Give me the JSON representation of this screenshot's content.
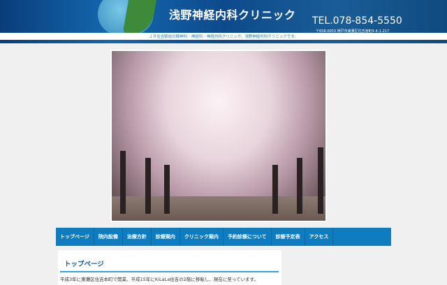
{
  "header": {
    "title": "浅野神経内科クリニック",
    "tel": "TEL.078-854-5550",
    "address": "〒658-0053 神戸市東灘区住吉宮町4-4-1-217",
    "tagline": "ＪＲ住吉駅前の精神科・神経科・神経内科クリニック。浅野神経内科クリニックです。"
  },
  "nav": [
    "トップページ",
    "院内設備",
    "治療方針",
    "診療案内",
    "クリニック案内",
    "予約診療について",
    "診療予定表",
    "アクセス"
  ],
  "content": {
    "heading": "トップページ",
    "text": "平成3年に東灘区住吉本町で開業、平成15年にKiLaLa住吉の2階に移転し、現在に至っています。"
  }
}
